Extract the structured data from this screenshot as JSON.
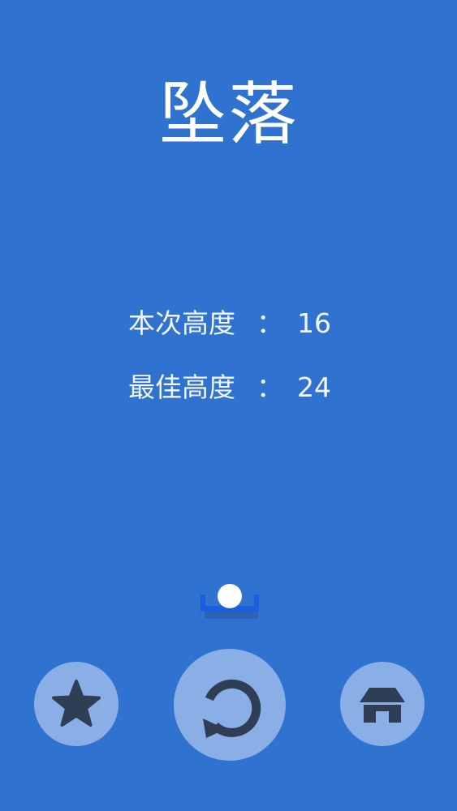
{
  "game": {
    "title": "坠落"
  },
  "stats": {
    "current": {
      "label": "本次高度",
      "colon": "：",
      "value": "16"
    },
    "best": {
      "label": "最佳高度",
      "colon": "：",
      "value": "24"
    }
  },
  "buttons": {
    "rate": {
      "icon": "star-icon"
    },
    "replay": {
      "icon": "replay-icon"
    },
    "home": {
      "icon": "home-icon"
    }
  },
  "colors": {
    "background": "#2f72cf",
    "button": "#8aaee6",
    "icon": "#2f3d55",
    "cup": "#1a5fe0",
    "ball": "#ffffff"
  }
}
